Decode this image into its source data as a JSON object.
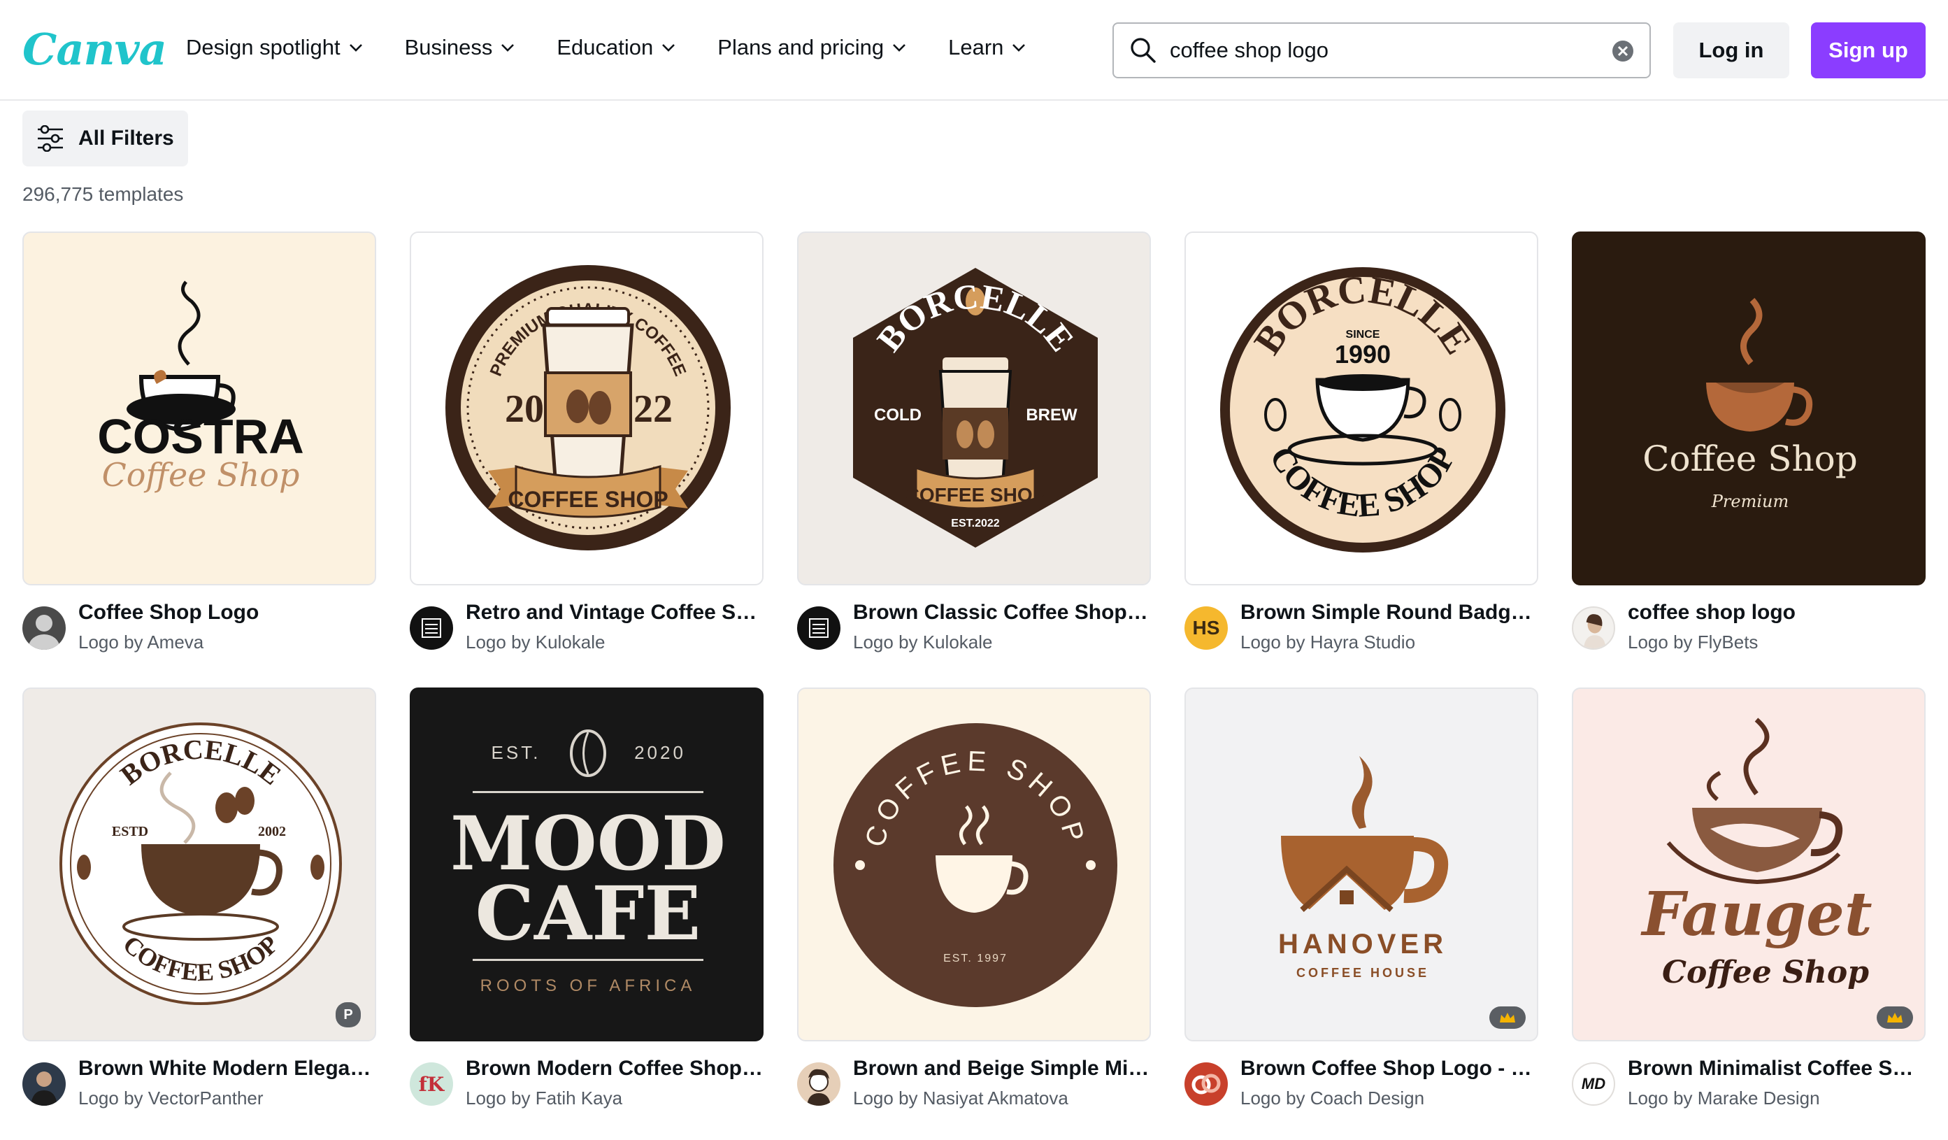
{
  "header": {
    "logo_text": "Canva",
    "nav": [
      {
        "label": "Design spotlight"
      },
      {
        "label": "Business"
      },
      {
        "label": "Education"
      },
      {
        "label": "Plans and pricing"
      },
      {
        "label": "Learn"
      }
    ],
    "search": {
      "value": "coffee shop logo",
      "placeholder": "Search"
    },
    "login_label": "Log in",
    "signup_label": "Sign up"
  },
  "toolbar": {
    "filters_label": "All Filters"
  },
  "results": {
    "count_text": "296,775 templates"
  },
  "cards": [
    {
      "title": "Coffee Shop Logo",
      "by": "Logo by Ameva",
      "art": {
        "brand": "COSTRA",
        "script": "Coffee Shop"
      }
    },
    {
      "title": "Retro and Vintage Coffee Sho...",
      "by": "Logo by Kulokale",
      "art": {
        "arc": "PREMIUM QUALITY COFFEE",
        "left_year": "20",
        "right_year": "22",
        "ribbon": "COFFEE SHOP"
      }
    },
    {
      "title": "Brown Classic Coffee Shop B...",
      "by": "Logo by Kulokale",
      "art": {
        "brand": "BORCELLE",
        "left": "COLD",
        "right": "BREW",
        "ribbon": "COFFEE SHOP",
        "est": "EST.2022"
      }
    },
    {
      "title": "Brown Simple Round Badge C...",
      "by": "Logo by Hayra Studio",
      "avatar_text": "HS",
      "art": {
        "brand": "BORCELLE",
        "since": "SINCE",
        "year": "1990",
        "bottom": "COFFEE SHOP"
      }
    },
    {
      "title": "coffee shop logo",
      "by": "Logo by FlyBets",
      "art": {
        "name": "Coffee Shop",
        "sub": "Premium"
      }
    },
    {
      "title": "Brown White Modern Elegant ...",
      "by": "Logo by VectorPanther",
      "badge": "P",
      "art": {
        "brand": "BORCELLE",
        "estd": "ESTD",
        "year": "2002",
        "bottom": "COFFEE SHOP"
      }
    },
    {
      "title": "Brown Modern Coffee Shop L...",
      "by": "Logo by Fatih Kaya",
      "avatar_text": "fK",
      "art": {
        "est": "EST.",
        "year": "2020",
        "line1": "MOOD",
        "line2": "CAFE",
        "sub": "ROOTS OF AFRICA"
      }
    },
    {
      "title": "Brown and Beige Simple Mini...",
      "by": "Logo by Nasiyat Akmatova",
      "art": {
        "arc": "COFFEE SHOP",
        "est": "EST. 1997"
      }
    },
    {
      "title": "Brown Coffee Shop Logo - Lo...",
      "by": "Logo by Coach Design",
      "badge": "crown",
      "art": {
        "brand": "HANOVER",
        "sub": "COFFEE HOUSE"
      }
    },
    {
      "title": "Brown Minimalist Coffee Sho...",
      "by": "Logo by Marake Design",
      "avatar_text": "MD",
      "badge": "crown",
      "art": {
        "brand": "Fauget",
        "sub": "Coffee Shop"
      }
    }
  ],
  "colors": {
    "brand_teal": "#20c4cb",
    "brand_purple": "#8b3dff",
    "coffee_brown": "#5a3a25",
    "crown_gold": "#f5b400"
  }
}
